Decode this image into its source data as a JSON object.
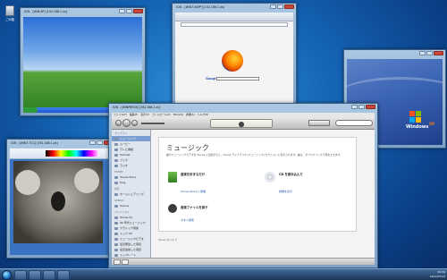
{
  "desktop": {
    "recycle_bin_label": "ごみ箱"
  },
  "windows": {
    "xp_vm": {
      "title": "ICW - [WIN-XP] [192.168.1.xx]"
    },
    "firefox_vm": {
      "title": "ICW - [WIN7-64PP] [192.168.1.xx]",
      "google_label": "Google"
    },
    "paint_vm": {
      "title": "ICW - [WIN7-7CC] [192.168.1.xx]"
    },
    "winxp_logo_vm": {
      "windows_label": "Windows",
      "xp_label": "XP"
    },
    "itunes_vm": {
      "title": "ICW - [WINPRPXX] [192.168.1.xx]",
      "menu": [
        "ファイル(F)",
        "編集(E)",
        "表示(V)",
        "コントロール(C)",
        "Store(S)",
        "詳細(A)",
        "ヘルプ(H)"
      ],
      "sidebar": {
        "sections": [
          {
            "header": "ライブラリ",
            "items": [
              "ミュージック",
              "ムービー",
              "テレビ番組",
              "Podcast",
              "ブック",
              "ラジオ"
            ]
          },
          {
            "header": "STORE",
            "items": [
              "iTunes Store",
              "Ping"
            ]
          },
          {
            "header": "共有",
            "items": [
              "ホームシェアリング"
            ]
          },
          {
            "header": "GENIUS",
            "items": [
              "Genius"
            ]
          },
          {
            "header": "プレイリスト",
            "items": [
              "iTunes DJ",
              "90 年代ミュージック",
              "クラシック音楽",
              "トップ 25",
              "ミュージックビデオ",
              "最近再生した項目",
              "最近追加した項目",
              "トップレート"
            ]
          }
        ]
      },
      "main": {
        "heading": "ミュージック",
        "description": "曲やミュージックビデオを iTunes に追加すると、iTunes ライブラリの [ミュージック] セクションに表示されます。曲は、ダブルクリックで再生できます。",
        "option1_title": "音楽を好きなだけ",
        "option1_link": "iTunes Store に移動",
        "option2_title": "CD を読み込んで",
        "option2_link": "詳細を表示",
        "option3_title": "音楽ファイルを探す",
        "option3_link": "今すぐ検索",
        "footer": "iTunes のヘルプ"
      }
    }
  },
  "taskbar": {
    "clock_time": "20:36",
    "clock_date": "2011/07/13"
  }
}
